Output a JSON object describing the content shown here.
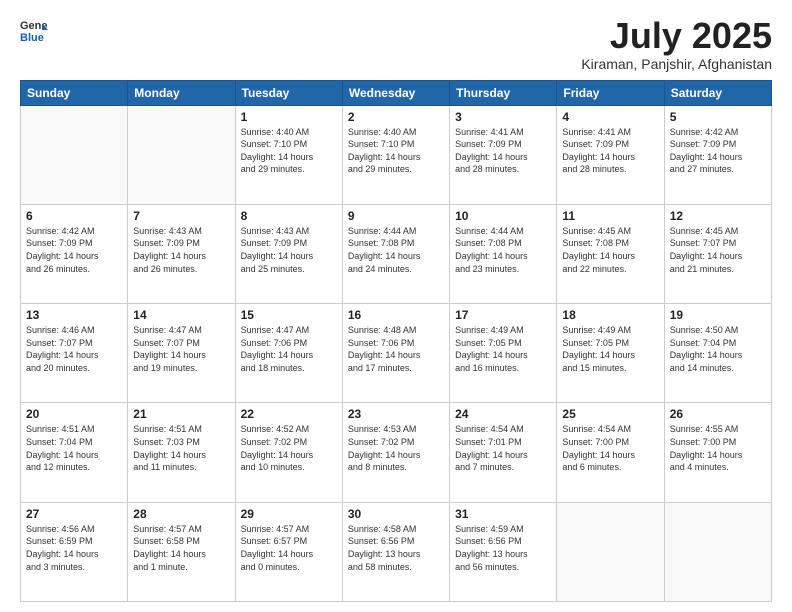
{
  "header": {
    "logo_line1": "General",
    "logo_line2": "Blue",
    "title": "July 2025",
    "location": "Kiraman, Panjshir, Afghanistan"
  },
  "days_of_week": [
    "Sunday",
    "Monday",
    "Tuesday",
    "Wednesday",
    "Thursday",
    "Friday",
    "Saturday"
  ],
  "weeks": [
    [
      {
        "day": "",
        "detail": ""
      },
      {
        "day": "",
        "detail": ""
      },
      {
        "day": "1",
        "detail": "Sunrise: 4:40 AM\nSunset: 7:10 PM\nDaylight: 14 hours\nand 29 minutes."
      },
      {
        "day": "2",
        "detail": "Sunrise: 4:40 AM\nSunset: 7:10 PM\nDaylight: 14 hours\nand 29 minutes."
      },
      {
        "day": "3",
        "detail": "Sunrise: 4:41 AM\nSunset: 7:09 PM\nDaylight: 14 hours\nand 28 minutes."
      },
      {
        "day": "4",
        "detail": "Sunrise: 4:41 AM\nSunset: 7:09 PM\nDaylight: 14 hours\nand 28 minutes."
      },
      {
        "day": "5",
        "detail": "Sunrise: 4:42 AM\nSunset: 7:09 PM\nDaylight: 14 hours\nand 27 minutes."
      }
    ],
    [
      {
        "day": "6",
        "detail": "Sunrise: 4:42 AM\nSunset: 7:09 PM\nDaylight: 14 hours\nand 26 minutes."
      },
      {
        "day": "7",
        "detail": "Sunrise: 4:43 AM\nSunset: 7:09 PM\nDaylight: 14 hours\nand 26 minutes."
      },
      {
        "day": "8",
        "detail": "Sunrise: 4:43 AM\nSunset: 7:09 PM\nDaylight: 14 hours\nand 25 minutes."
      },
      {
        "day": "9",
        "detail": "Sunrise: 4:44 AM\nSunset: 7:08 PM\nDaylight: 14 hours\nand 24 minutes."
      },
      {
        "day": "10",
        "detail": "Sunrise: 4:44 AM\nSunset: 7:08 PM\nDaylight: 14 hours\nand 23 minutes."
      },
      {
        "day": "11",
        "detail": "Sunrise: 4:45 AM\nSunset: 7:08 PM\nDaylight: 14 hours\nand 22 minutes."
      },
      {
        "day": "12",
        "detail": "Sunrise: 4:45 AM\nSunset: 7:07 PM\nDaylight: 14 hours\nand 21 minutes."
      }
    ],
    [
      {
        "day": "13",
        "detail": "Sunrise: 4:46 AM\nSunset: 7:07 PM\nDaylight: 14 hours\nand 20 minutes."
      },
      {
        "day": "14",
        "detail": "Sunrise: 4:47 AM\nSunset: 7:07 PM\nDaylight: 14 hours\nand 19 minutes."
      },
      {
        "day": "15",
        "detail": "Sunrise: 4:47 AM\nSunset: 7:06 PM\nDaylight: 14 hours\nand 18 minutes."
      },
      {
        "day": "16",
        "detail": "Sunrise: 4:48 AM\nSunset: 7:06 PM\nDaylight: 14 hours\nand 17 minutes."
      },
      {
        "day": "17",
        "detail": "Sunrise: 4:49 AM\nSunset: 7:05 PM\nDaylight: 14 hours\nand 16 minutes."
      },
      {
        "day": "18",
        "detail": "Sunrise: 4:49 AM\nSunset: 7:05 PM\nDaylight: 14 hours\nand 15 minutes."
      },
      {
        "day": "19",
        "detail": "Sunrise: 4:50 AM\nSunset: 7:04 PM\nDaylight: 14 hours\nand 14 minutes."
      }
    ],
    [
      {
        "day": "20",
        "detail": "Sunrise: 4:51 AM\nSunset: 7:04 PM\nDaylight: 14 hours\nand 12 minutes."
      },
      {
        "day": "21",
        "detail": "Sunrise: 4:51 AM\nSunset: 7:03 PM\nDaylight: 14 hours\nand 11 minutes."
      },
      {
        "day": "22",
        "detail": "Sunrise: 4:52 AM\nSunset: 7:02 PM\nDaylight: 14 hours\nand 10 minutes."
      },
      {
        "day": "23",
        "detail": "Sunrise: 4:53 AM\nSunset: 7:02 PM\nDaylight: 14 hours\nand 8 minutes."
      },
      {
        "day": "24",
        "detail": "Sunrise: 4:54 AM\nSunset: 7:01 PM\nDaylight: 14 hours\nand 7 minutes."
      },
      {
        "day": "25",
        "detail": "Sunrise: 4:54 AM\nSunset: 7:00 PM\nDaylight: 14 hours\nand 6 minutes."
      },
      {
        "day": "26",
        "detail": "Sunrise: 4:55 AM\nSunset: 7:00 PM\nDaylight: 14 hours\nand 4 minutes."
      }
    ],
    [
      {
        "day": "27",
        "detail": "Sunrise: 4:56 AM\nSunset: 6:59 PM\nDaylight: 14 hours\nand 3 minutes."
      },
      {
        "day": "28",
        "detail": "Sunrise: 4:57 AM\nSunset: 6:58 PM\nDaylight: 14 hours\nand 1 minute."
      },
      {
        "day": "29",
        "detail": "Sunrise: 4:57 AM\nSunset: 6:57 PM\nDaylight: 14 hours\nand 0 minutes."
      },
      {
        "day": "30",
        "detail": "Sunrise: 4:58 AM\nSunset: 6:56 PM\nDaylight: 13 hours\nand 58 minutes."
      },
      {
        "day": "31",
        "detail": "Sunrise: 4:59 AM\nSunset: 6:56 PM\nDaylight: 13 hours\nand 56 minutes."
      },
      {
        "day": "",
        "detail": ""
      },
      {
        "day": "",
        "detail": ""
      }
    ]
  ]
}
